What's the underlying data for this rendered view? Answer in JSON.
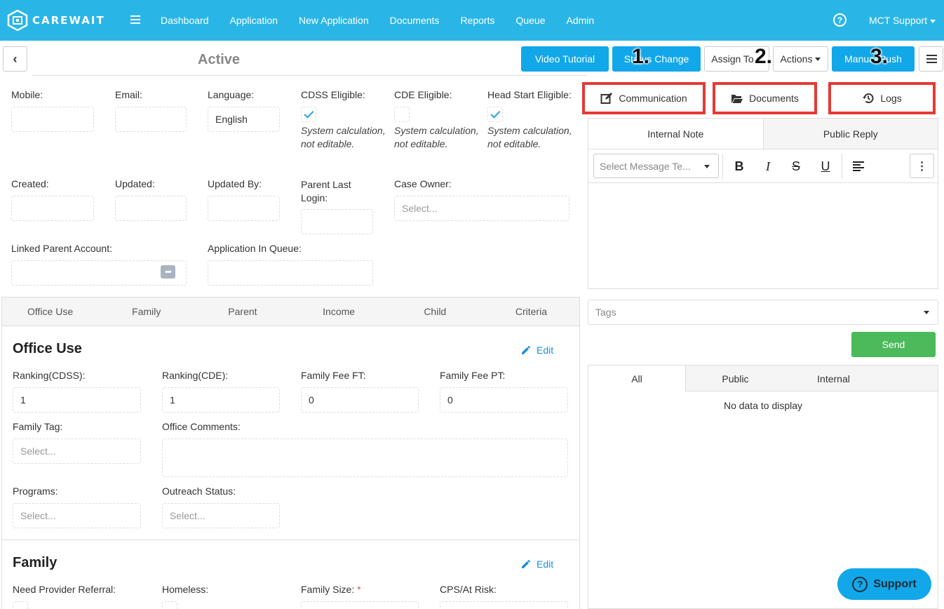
{
  "app": {
    "brand": "CAREWAIT"
  },
  "nav": {
    "items": [
      "Dashboard",
      "Application",
      "New Application",
      "Documents",
      "Reports",
      "Queue",
      "Admin"
    ],
    "user": "MCT Support",
    "help_glyph": "?"
  },
  "header": {
    "status": "Active",
    "buttons": {
      "video_tutorial": "Video Tutorial",
      "status_change": "Status Change",
      "assign_to": "Assign To",
      "actions": "Actions",
      "manual_push": "Manual Push"
    },
    "steps": [
      "1.",
      "2.",
      "3."
    ]
  },
  "form": {
    "mobile": {
      "label": "Mobile:",
      "value": ""
    },
    "email": {
      "label": "Email:",
      "value": ""
    },
    "language": {
      "label": "Language:",
      "value": "English"
    },
    "cdss": {
      "label": "CDSS Eligible:",
      "checked": true,
      "note": "System calculation, not editable."
    },
    "cde": {
      "label": "CDE Eligible:",
      "checked": false,
      "note": "System calculation, not editable."
    },
    "headstart": {
      "label": "Head Start Eligible:",
      "checked": true,
      "note": "System calculation, not editable."
    },
    "created": {
      "label": "Created:",
      "value": ""
    },
    "updated": {
      "label": "Updated:",
      "value": ""
    },
    "updated_by": {
      "label": "Updated By:",
      "value": ""
    },
    "parent_last_login": {
      "label": "Parent Last Login:",
      "value": ""
    },
    "case_owner": {
      "label": "Case Owner:",
      "placeholder": "Select..."
    },
    "linked_parent": {
      "label": "Linked Parent Account:",
      "value": ""
    },
    "app_in_queue": {
      "label": "Application In Queue:",
      "value": ""
    }
  },
  "section_tabs": [
    "Office Use",
    "Family",
    "Parent",
    "Income",
    "Child",
    "Criteria"
  ],
  "office_use": {
    "title": "Office Use",
    "edit": "Edit",
    "ranking_cdss": {
      "label": "Ranking(CDSS):",
      "value": "1"
    },
    "ranking_cde": {
      "label": "Ranking(CDE):",
      "value": "1"
    },
    "fee_ft": {
      "label": "Family Fee FT:",
      "value": "0"
    },
    "fee_pt": {
      "label": "Family Fee PT:",
      "value": "0"
    },
    "family_tag": {
      "label": "Family Tag:",
      "placeholder": "Select..."
    },
    "office_comments": {
      "label": "Office Comments:",
      "value": ""
    },
    "programs": {
      "label": "Programs:",
      "placeholder": "Select..."
    },
    "outreach": {
      "label": "Outreach Status:",
      "placeholder": "Select..."
    }
  },
  "family": {
    "title": "Family",
    "edit": "Edit",
    "provider_referral": "Need Provider Referral:",
    "homeless": "Homeless:",
    "family_size": "Family Size:",
    "required_mark": "*",
    "cps": "CPS/At Risk:"
  },
  "right": {
    "tabs": {
      "communication": "Communication",
      "documents": "Documents",
      "logs": "Logs"
    },
    "msg_tabs": [
      "Internal Note",
      "Public Reply"
    ],
    "template_placeholder": "Select Message Te...",
    "toolbar": {
      "bold": "B",
      "italic": "I",
      "strike": "S",
      "underline": "U",
      "more": "⋮"
    },
    "tags_placeholder": "Tags",
    "send": "Send",
    "log_tabs": [
      "All",
      "Public",
      "Internal"
    ],
    "empty": "No data to display"
  },
  "support": {
    "label": "Support",
    "glyph": "?"
  },
  "colors": {
    "nav": "#29b6e6",
    "primary": "#12a7e8",
    "send": "#4cb95a",
    "highlight": "#e53935",
    "link": "#1a90d9"
  }
}
